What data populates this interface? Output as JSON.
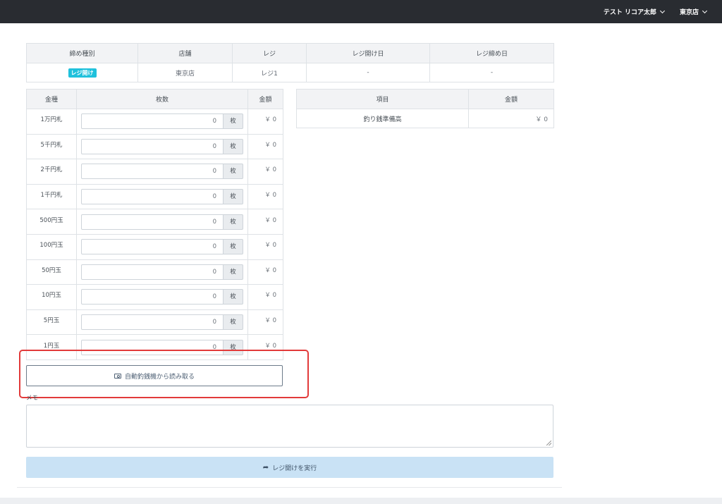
{
  "header": {
    "user_name": "テスト リコア太郎",
    "store_name": "東京店"
  },
  "summary": {
    "headers": [
      "締め種別",
      "店舗",
      "レジ",
      "レジ開け日",
      "レジ締め日"
    ],
    "type_badge": "レジ開け",
    "store": "東京店",
    "register": "レジ1",
    "open_date": "-",
    "close_date": "-"
  },
  "cash": {
    "headers": [
      "金種",
      "枚数",
      "金額"
    ],
    "unit": "枚",
    "rows": [
      {
        "denomination": "1万円札",
        "count": "0",
        "amount": "￥ 0"
      },
      {
        "denomination": "5千円札",
        "count": "0",
        "amount": "￥ 0"
      },
      {
        "denomination": "2千円札",
        "count": "0",
        "amount": "￥ 0"
      },
      {
        "denomination": "1千円札",
        "count": "0",
        "amount": "￥ 0"
      },
      {
        "denomination": "500円玉",
        "count": "0",
        "amount": "￥ 0"
      },
      {
        "denomination": "100円玉",
        "count": "0",
        "amount": "￥ 0"
      },
      {
        "denomination": "50円玉",
        "count": "0",
        "amount": "￥ 0"
      },
      {
        "denomination": "10円玉",
        "count": "0",
        "amount": "￥ 0"
      },
      {
        "denomination": "5円玉",
        "count": "0",
        "amount": "￥ 0"
      },
      {
        "denomination": "1円玉",
        "count": "0",
        "amount": "￥ 0"
      }
    ]
  },
  "items": {
    "headers": [
      "項目",
      "金額"
    ],
    "rows": [
      {
        "label": "釣り銭準備高",
        "amount": "￥ 0"
      }
    ]
  },
  "read_button": "自動釣銭機から読み取る",
  "memo_label": "メモ",
  "submit_button": "レジ開けを実行",
  "colors": {
    "topbar": "#292c31",
    "badge": "#1fc1dc",
    "highlight": "#e23a3a",
    "submit_bg": "#c9e2f5"
  }
}
